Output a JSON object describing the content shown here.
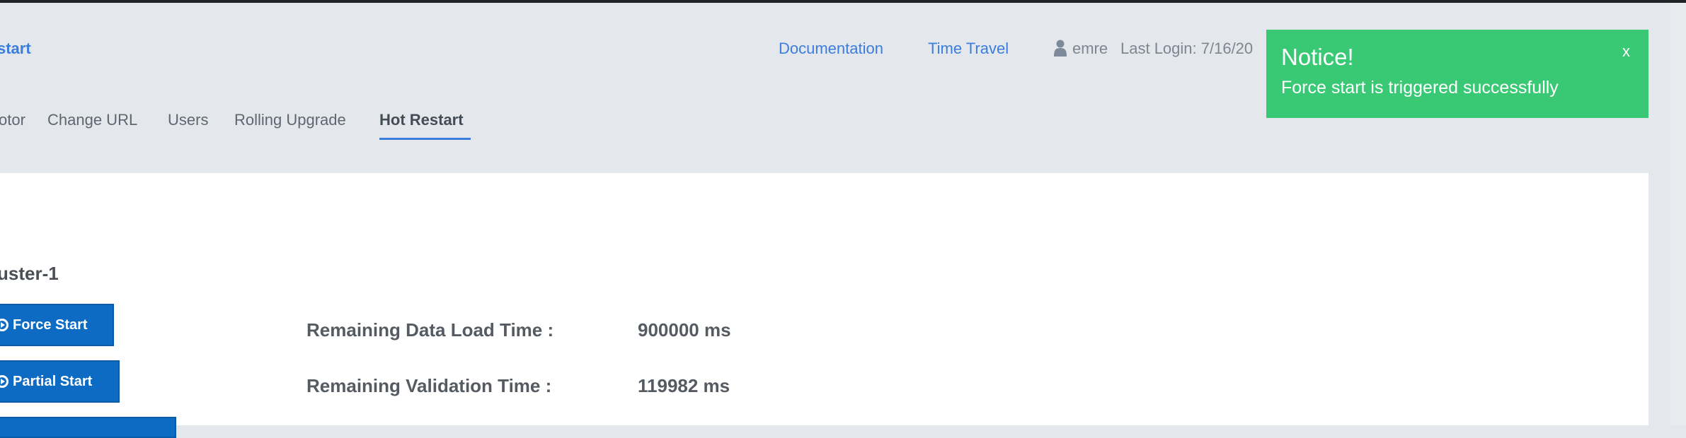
{
  "header": {
    "brand": "start",
    "links": [
      "Documentation",
      "Time Travel"
    ],
    "user": {
      "icon": "user-icon",
      "name": "emre",
      "last_login": "Last Login: 7/16/20"
    }
  },
  "nav": {
    "tabs": [
      {
        "label": "otor",
        "active": false
      },
      {
        "label": "Change URL",
        "active": false
      },
      {
        "label": "Users",
        "active": false
      },
      {
        "label": "Rolling Upgrade",
        "active": false
      },
      {
        "label": "Hot Restart",
        "active": true
      }
    ]
  },
  "main": {
    "cluster_name": "uster-1",
    "buttons": [
      {
        "label": "Force Start",
        "icon": "play-circle-icon"
      },
      {
        "label": "Partial Start",
        "icon": "play-circle-icon"
      }
    ],
    "stats": [
      {
        "label": "Remaining Data Load Time :",
        "value": "900000 ms"
      },
      {
        "label": "Remaining Validation Time :",
        "value": "119982 ms"
      }
    ]
  },
  "notice": {
    "title": "Notice!",
    "message": "Force start is triggered successfully",
    "close": "x",
    "color": "#39c874"
  },
  "colors": {
    "accent": "#3b7ddd",
    "button": "#0e6bc4"
  }
}
